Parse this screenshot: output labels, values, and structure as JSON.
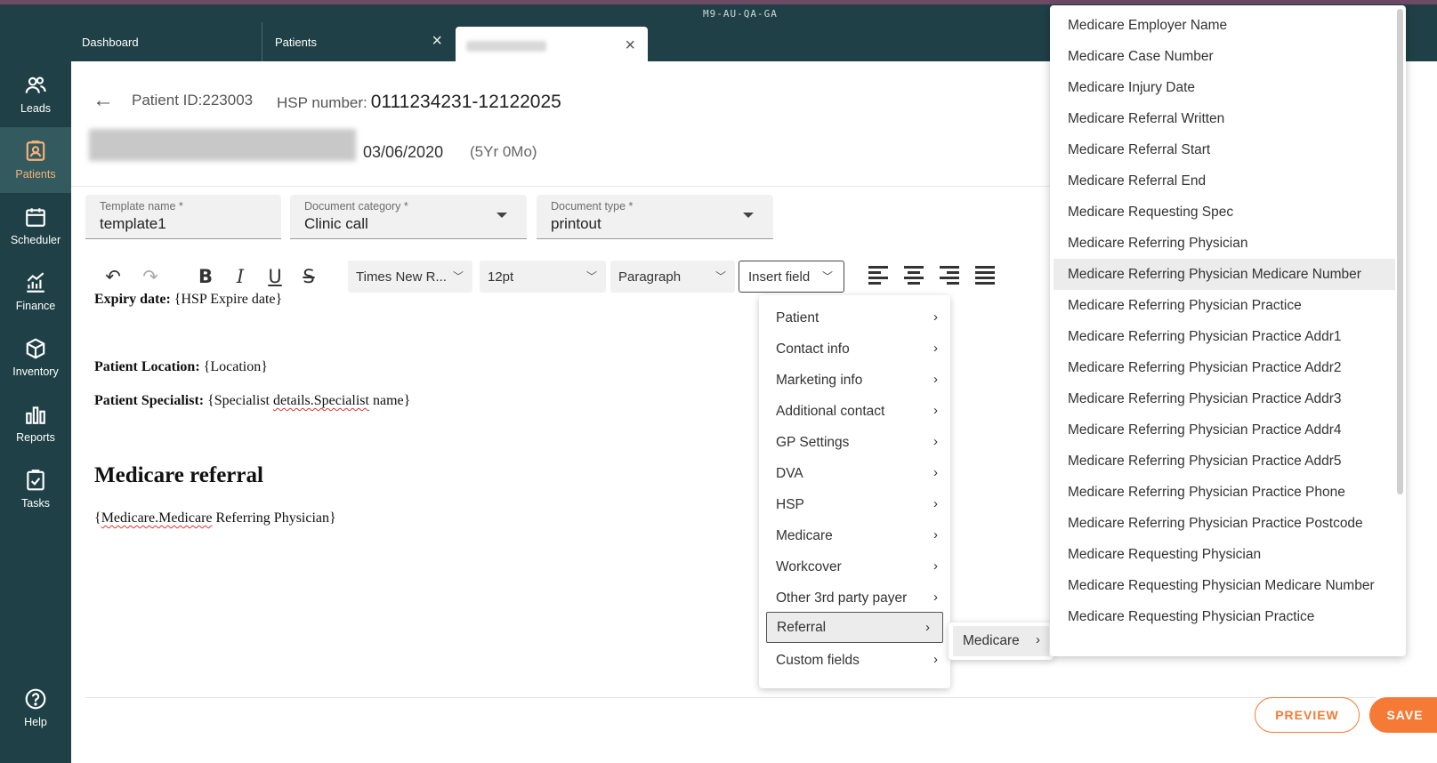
{
  "env": "M9-AU-QA-GA",
  "tabs": [
    {
      "label": "Dashboard"
    },
    {
      "label": "Patients"
    },
    {
      "label": ""
    }
  ],
  "sidebar": {
    "items": [
      {
        "label": "Leads",
        "icon": "people-icon"
      },
      {
        "label": "Patients",
        "icon": "patient-card-icon",
        "active": true
      },
      {
        "label": "Scheduler",
        "icon": "calendar-icon"
      },
      {
        "label": "Finance",
        "icon": "chart-icon"
      },
      {
        "label": "Inventory",
        "icon": "box-icon"
      },
      {
        "label": "Reports",
        "icon": "bar-chart-icon"
      },
      {
        "label": "Tasks",
        "icon": "checklist-icon"
      }
    ],
    "help": "Help"
  },
  "header": {
    "patient_id_label": "Patient ID:",
    "patient_id": "223003",
    "hsp_label": "HSP number:",
    "hsp_number": "0111234231-12122025",
    "dob": "03/06/2020",
    "age": "(5Yr 0Mo)"
  },
  "form": {
    "template_name_label": "Template name *",
    "template_name": "template1",
    "doc_category_label": "Document category *",
    "doc_category": "Clinic call",
    "doc_type_label": "Document type *",
    "doc_type": "printout"
  },
  "toolbar": {
    "font": "Times New R...",
    "size": "12pt",
    "block": "Paragraph",
    "insert_field": "Insert field"
  },
  "editor": {
    "expiry_label": "Expiry date:",
    "expiry_value": "{HSP Expire date}",
    "location_label": "Patient Location:",
    "location_value": "{Location}",
    "specialist_label": "Patient Specialist:",
    "specialist_value_a": "{Specialist ",
    "specialist_value_b": "details.Specialist",
    "specialist_value_c": " name}",
    "heading": "Medicare referral",
    "field_a": "{",
    "field_b": "Medicare.Medicare",
    "field_c": " Referring Physician}"
  },
  "actions": {
    "preview": "PREVIEW",
    "save": "SAVE"
  },
  "insert_menu": [
    "Patient",
    "Contact info",
    "Marketing info",
    "Additional contact",
    "GP Settings",
    "DVA",
    "HSP",
    "Medicare",
    "Workcover",
    "Other 3rd party payer",
    "Referral",
    "Custom fields"
  ],
  "submenu": {
    "label": "Medicare"
  },
  "field_list": [
    "Medicare Employer Name",
    "Medicare Case Number",
    "Medicare Injury Date",
    "Medicare Referral Written",
    "Medicare Referral Start",
    "Medicare Referral End",
    "Medicare Requesting Spec",
    "Medicare Referring Physician",
    "Medicare Referring Physician Medicare Number",
    "Medicare Referring Physician Practice",
    "Medicare Referring Physician Practice Addr1",
    "Medicare Referring Physician Practice Addr2",
    "Medicare Referring Physician Practice Addr3",
    "Medicare Referring Physician Practice Addr4",
    "Medicare Referring Physician Practice Addr5",
    "Medicare Referring Physician Practice Phone",
    "Medicare Referring Physician Practice Postcode",
    "Medicare Requesting Physician",
    "Medicare Requesting Physician Medicare Number",
    "Medicare Requesting Physician Practice"
  ],
  "colors": {
    "sidebar": "#1f4046",
    "accent": "#f47a35",
    "active_nav_text": "#f7b27a"
  }
}
